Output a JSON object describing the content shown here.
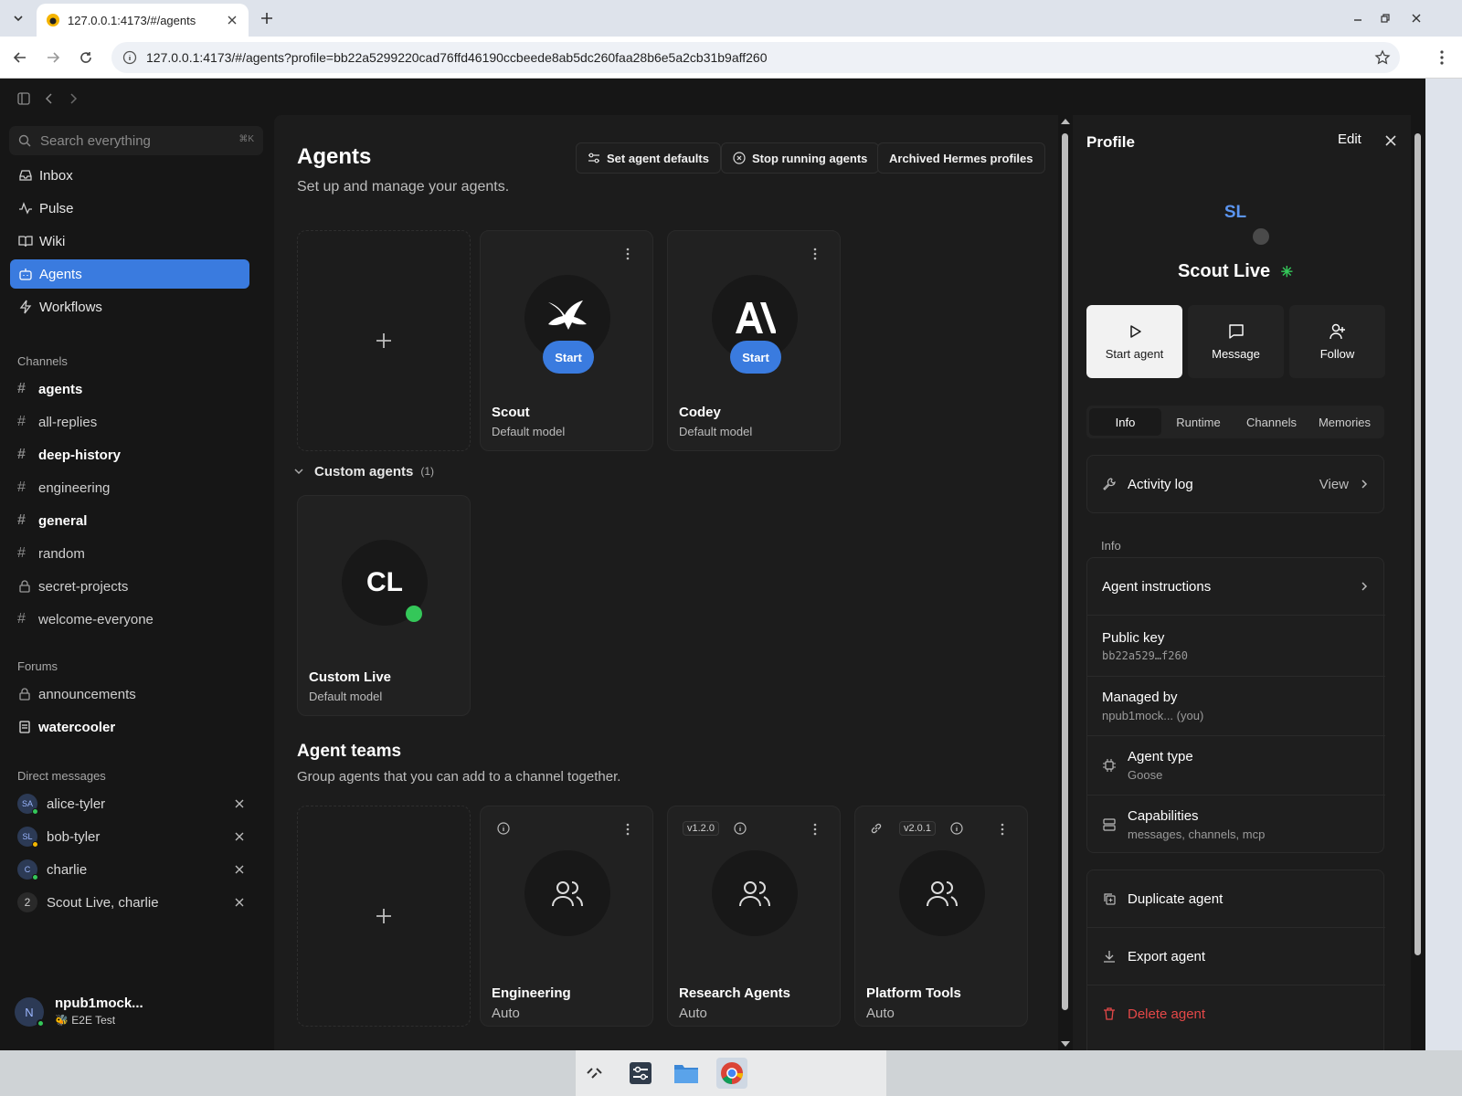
{
  "browser": {
    "tab_title": "127.0.0.1:4173/#/agents",
    "url": "127.0.0.1:4173/#/agents?profile=bb22a5299220cad76ffd46190ccbeede8ab5dc260faa28b6e5a2cb31b9aff260"
  },
  "sidebar": {
    "search_placeholder": "Search everything",
    "search_shortcut": "⌘K",
    "nav": [
      {
        "label": "Inbox",
        "icon": "inbox-icon"
      },
      {
        "label": "Pulse",
        "icon": "pulse-icon"
      },
      {
        "label": "Wiki",
        "icon": "book-icon"
      },
      {
        "label": "Agents",
        "icon": "bot-icon",
        "active": true
      },
      {
        "label": "Workflows",
        "icon": "bolt-icon"
      }
    ],
    "channels_header": "Channels",
    "channels": [
      {
        "name": "agents",
        "bold": true
      },
      {
        "name": "all-replies"
      },
      {
        "name": "deep-history",
        "bold": true
      },
      {
        "name": "engineering"
      },
      {
        "name": "general",
        "bold": true
      },
      {
        "name": "random"
      },
      {
        "name": "secret-projects",
        "locked": true
      },
      {
        "name": "welcome-everyone"
      }
    ],
    "forums_header": "Forums",
    "forums": [
      {
        "name": "announcements",
        "locked": true
      },
      {
        "name": "watercooler",
        "bold": true
      }
    ],
    "dm_header": "Direct messages",
    "dms": [
      {
        "name": "alice-tyler",
        "initials": "SA"
      },
      {
        "name": "bob-tyler",
        "initials": "SL"
      },
      {
        "name": "charlie",
        "initials": "C"
      },
      {
        "name": "Scout Live, charlie",
        "initials": "2"
      }
    ],
    "user": {
      "name": "npub1mock...",
      "status": "E2E Test",
      "initial": "N"
    }
  },
  "main": {
    "title": "Agents",
    "subtitle": "Set up and manage your agents.",
    "buttons": {
      "defaults": "Set agent defaults",
      "stop": "Stop running agents",
      "archived": "Archived Hermes profiles"
    },
    "agents": [
      {
        "name": "Scout",
        "model": "Default model",
        "start": "Start"
      },
      {
        "name": "Codey",
        "model": "Default model",
        "start": "Start"
      }
    ],
    "custom_group": {
      "label": "Custom agents",
      "count": "(1)"
    },
    "custom_agents": [
      {
        "name": "Custom Live",
        "model": "Default model",
        "initials": "CL"
      }
    ],
    "teams_title": "Agent teams",
    "teams_subtitle": "Group agents that you can add to a channel together.",
    "teams": [
      {
        "name": "Engineering",
        "model": "Auto",
        "version": ""
      },
      {
        "name": "Research Agents",
        "model": "Auto",
        "version": "v1.2.0"
      },
      {
        "name": "Platform Tools",
        "model": "Auto",
        "version": "v2.0.1"
      }
    ]
  },
  "profile": {
    "title": "Profile",
    "edit": "Edit",
    "initials": "SL",
    "name": "Scout Live",
    "actions": {
      "start": "Start agent",
      "message": "Message",
      "follow": "Follow"
    },
    "tabs": [
      "Info",
      "Runtime",
      "Channels",
      "Memories"
    ],
    "activity_log": {
      "label": "Activity log",
      "action": "View"
    },
    "info_header": "Info",
    "instructions": "Agent instructions",
    "public_key": {
      "label": "Public key",
      "value": "bb22a529…f260"
    },
    "managed_by": {
      "label": "Managed by",
      "value": "npub1mock... (you)"
    },
    "agent_type": {
      "label": "Agent type",
      "value": "Goose"
    },
    "capabilities": {
      "label": "Capabilities",
      "value": "messages, channels, mcp"
    },
    "duplicate": "Duplicate agent",
    "export": "Export agent",
    "delete": "Delete agent"
  }
}
